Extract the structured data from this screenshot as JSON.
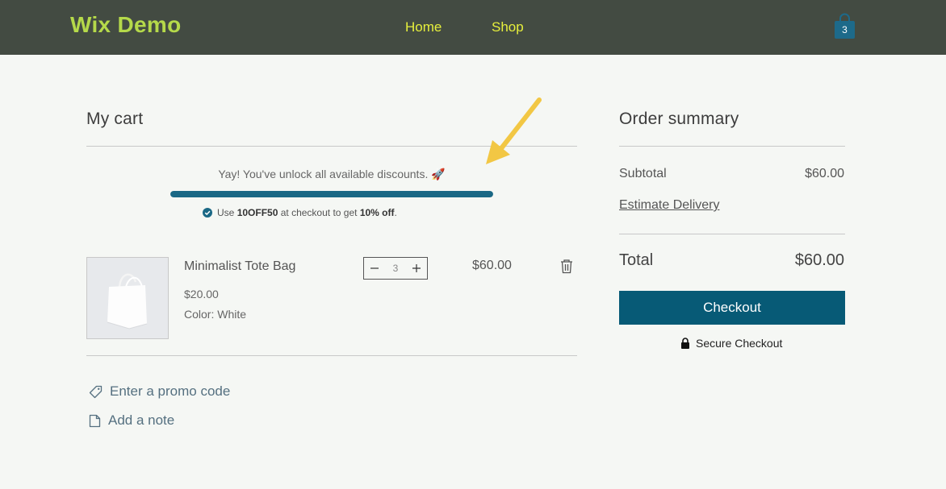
{
  "header": {
    "brand": "Wix Demo",
    "nav": [
      {
        "label": "Home"
      },
      {
        "label": "Shop"
      }
    ],
    "cart_count": "3"
  },
  "cart": {
    "title": "My cart",
    "discount_message": "Yay! You've unlock all available discounts. 🚀",
    "discount_progress": 1.0,
    "coupon": {
      "prefix": "Use",
      "code": "10OFF50",
      "middle": "at checkout to get",
      "amount": "10% off",
      "suffix": "."
    },
    "items": [
      {
        "name": "Minimalist Tote Bag",
        "unit_price": "$20.00",
        "color": "Color: White",
        "quantity": "3",
        "total": "$60.00"
      }
    ],
    "promo_label": "Enter a promo code",
    "note_label": "Add a note"
  },
  "summary": {
    "title": "Order summary",
    "subtotal_label": "Subtotal",
    "subtotal_value": "$60.00",
    "estimate_label": "Estimate Delivery",
    "total_label": "Total",
    "total_value": "$60.00",
    "checkout_label": "Checkout",
    "secure_label": "Secure Checkout"
  },
  "colors": {
    "header_bg": "#434b42",
    "brand": "#b5d94a",
    "nav": "#e6ef3c",
    "accent": "#075a76",
    "progress": "#1a6885",
    "annotation_arrow": "#f2c744"
  },
  "icons": {
    "cart": "shopping-bag-icon",
    "check": "check-circle-icon",
    "trash": "trash-icon",
    "promo": "tag-icon",
    "note": "note-icon",
    "lock": "lock-icon",
    "minus": "minus-icon",
    "plus": "plus-icon"
  }
}
